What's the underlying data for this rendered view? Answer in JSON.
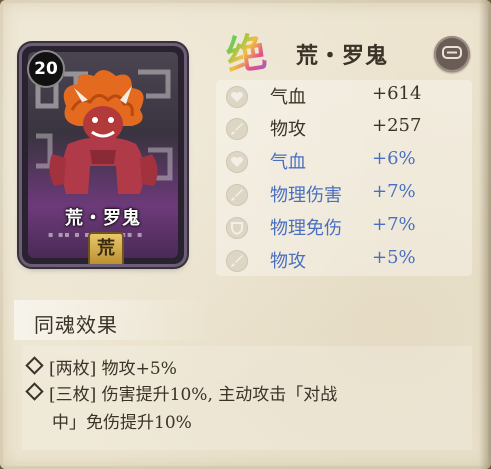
{
  "card": {
    "level": "20",
    "name": "荒・罗鬼",
    "badge": "荒"
  },
  "header": {
    "rank_glyph": "绝",
    "title": "荒・罗鬼",
    "menu_icon": "chat-bubble-icon"
  },
  "stats": [
    {
      "name": "气血",
      "value": "+614",
      "type": "main",
      "icon": "heart-icon"
    },
    {
      "name": "物攻",
      "value": "+257",
      "type": "main",
      "icon": "sword-icon"
    },
    {
      "name": "气血",
      "value": "+6%",
      "type": "sub",
      "icon": "heart-icon"
    },
    {
      "name": "物理伤害",
      "value": "+7%",
      "type": "sub",
      "icon": "sword-icon"
    },
    {
      "name": "物理免伤",
      "value": "+7%",
      "type": "sub",
      "icon": "shield-icon"
    },
    {
      "name": "物攻",
      "value": "+5%",
      "type": "sub",
      "icon": "sword-icon"
    }
  ],
  "tonghun": {
    "title": "同魂效果",
    "effects": [
      {
        "line1": "[两枚] 物攻+5%"
      },
      {
        "line1": "[三枚] 伤害提升10%, 主动攻击「对战",
        "line2": "中」免伤提升10%"
      }
    ]
  },
  "colors": {
    "main_text": "#3b3228",
    "sub_text": "#4a6fc0",
    "panel_bg": "#ece4cf"
  }
}
